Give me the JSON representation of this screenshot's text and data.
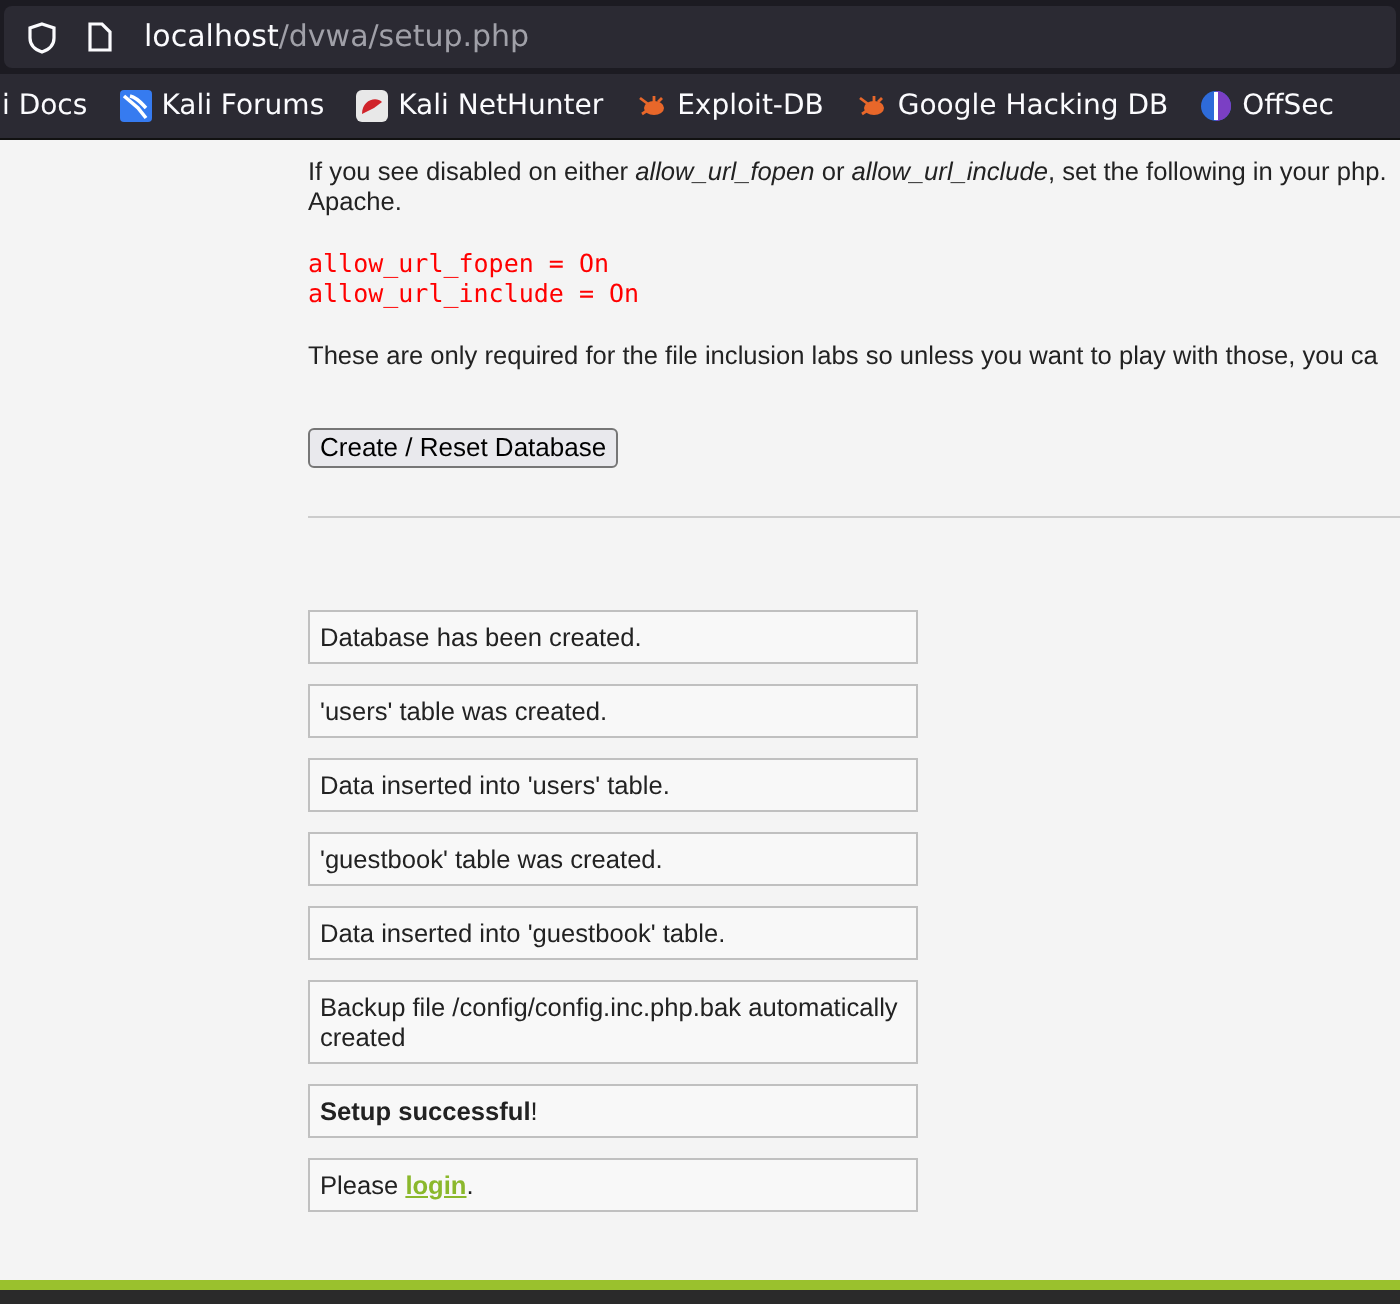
{
  "address_bar": {
    "host": "localhost",
    "path": "/dvwa/setup.php"
  },
  "bookmarks": [
    {
      "label": "i Docs",
      "kind": "plain"
    },
    {
      "label": "Kali Forums",
      "kind": "kali"
    },
    {
      "label": "Kali NetHunter",
      "kind": "nethunter"
    },
    {
      "label": "Exploit-DB",
      "kind": "bug"
    },
    {
      "label": "Google Hacking DB",
      "kind": "bug"
    },
    {
      "label": "OffSec",
      "kind": "offsec"
    }
  ],
  "intro": {
    "text": "If you see disabled on either *allow_url_fopen* or *allow_url_include*, set the following in your php.",
    "continuation": "Apache."
  },
  "settings": [
    "allow_url_fopen = On",
    "allow_url_include = On"
  ],
  "note": "These are only required for the file inclusion labs so unless you want to play with those, you ca",
  "reset_button": "Create / Reset Database",
  "messages": [
    {
      "kind": "plain",
      "text": "Database has been created."
    },
    {
      "kind": "plain",
      "text": "'users' table was created."
    },
    {
      "kind": "plain",
      "text": "Data inserted into 'users' table."
    },
    {
      "kind": "plain",
      "text": "'guestbook' table was created."
    },
    {
      "kind": "plain",
      "text": "Data inserted into 'guestbook' table."
    },
    {
      "kind": "plain",
      "text": "Backup file /config/config.inc.php.bak automatically created"
    },
    {
      "kind": "plain",
      "text": "**Setup successful**!"
    },
    {
      "kind": "link",
      "before": "Please ",
      "link": "login",
      "after": "."
    }
  ]
}
